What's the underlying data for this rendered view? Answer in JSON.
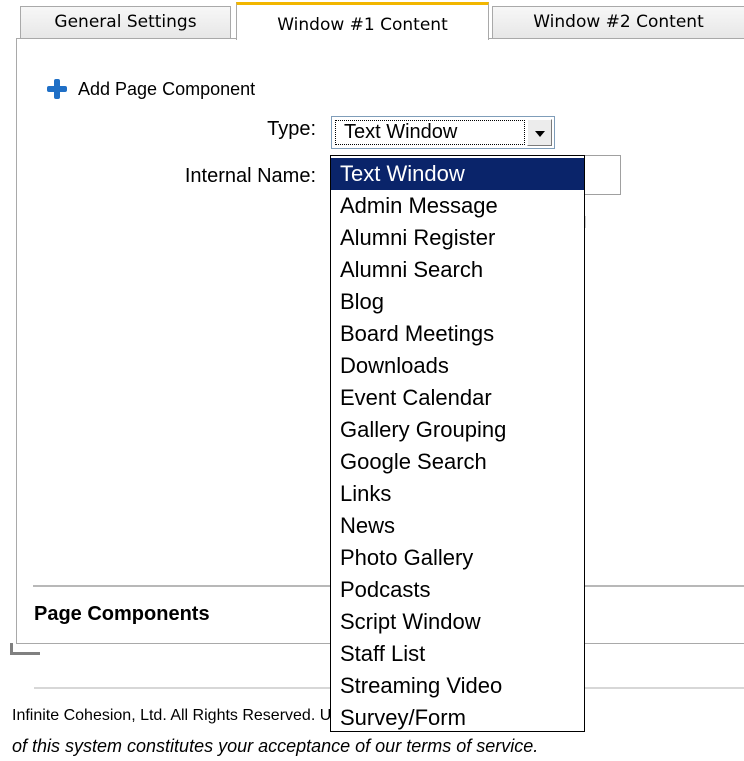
{
  "tabs": [
    {
      "label": "General Settings",
      "active": false
    },
    {
      "label": "Window #1 Content",
      "active": true
    },
    {
      "label": "Window #2 Content",
      "active": false
    }
  ],
  "accent_color": "#f2b600",
  "selection_color": "#0a246a",
  "form": {
    "add_component_label": "Add Page Component",
    "type_label": "Type:",
    "type_value": "Text Window",
    "internal_name_label": "Internal Name:"
  },
  "type_options": [
    "Text Window",
    "Admin Message",
    "Alumni Register",
    "Alumni Search",
    "Blog",
    "Board Meetings",
    "Downloads",
    "Event Calendar",
    "Gallery Grouping",
    "Google Search",
    "Links",
    "News",
    "Photo Gallery",
    "Podcasts",
    "Script Window",
    "Staff List",
    "Streaming Video",
    "Survey/Form"
  ],
  "section": {
    "page_components_title": "Page Components"
  },
  "footer": {
    "line1": "Infinite Cohesion, Ltd. All Rights Reserved. Use",
    "line2": "of this system constitutes your acceptance of our terms of service."
  }
}
